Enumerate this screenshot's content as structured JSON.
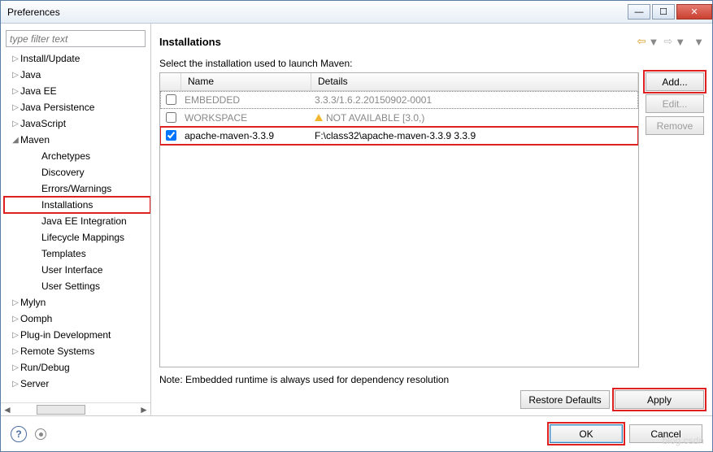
{
  "window": {
    "title": "Preferences"
  },
  "filter": {
    "placeholder": "type filter text"
  },
  "tree": {
    "items": [
      {
        "label": "Install/Update",
        "depth": 1,
        "exp": "▷"
      },
      {
        "label": "Java",
        "depth": 1,
        "exp": "▷"
      },
      {
        "label": "Java EE",
        "depth": 1,
        "exp": "▷"
      },
      {
        "label": "Java Persistence",
        "depth": 1,
        "exp": "▷"
      },
      {
        "label": "JavaScript",
        "depth": 1,
        "exp": "▷"
      },
      {
        "label": "Maven",
        "depth": 1,
        "exp": "◢"
      },
      {
        "label": "Archetypes",
        "depth": 2,
        "exp": ""
      },
      {
        "label": "Discovery",
        "depth": 2,
        "exp": ""
      },
      {
        "label": "Errors/Warnings",
        "depth": 2,
        "exp": ""
      },
      {
        "label": "Installations",
        "depth": 2,
        "exp": "",
        "hl": true
      },
      {
        "label": "Java EE Integration",
        "depth": 2,
        "exp": ""
      },
      {
        "label": "Lifecycle Mappings",
        "depth": 2,
        "exp": ""
      },
      {
        "label": "Templates",
        "depth": 2,
        "exp": ""
      },
      {
        "label": "User Interface",
        "depth": 2,
        "exp": ""
      },
      {
        "label": "User Settings",
        "depth": 2,
        "exp": ""
      },
      {
        "label": "Mylyn",
        "depth": 1,
        "exp": "▷"
      },
      {
        "label": "Oomph",
        "depth": 1,
        "exp": "▷"
      },
      {
        "label": "Plug-in Development",
        "depth": 1,
        "exp": "▷"
      },
      {
        "label": "Remote Systems",
        "depth": 1,
        "exp": "▷"
      },
      {
        "label": "Run/Debug",
        "depth": 1,
        "exp": "▷"
      },
      {
        "label": "Server",
        "depth": 1,
        "exp": "▷"
      }
    ]
  },
  "page": {
    "title": "Installations",
    "subtitle": "Select the installation used to launch Maven:",
    "columns": {
      "name": "Name",
      "details": "Details"
    },
    "rows": [
      {
        "checked": false,
        "name": "EMBEDDED",
        "details": "3.3.3/1.6.2.20150902-0001",
        "dotted": true
      },
      {
        "checked": false,
        "name": "WORKSPACE",
        "details": "NOT AVAILABLE [3.0,)",
        "warn": true
      },
      {
        "checked": true,
        "name": "apache-maven-3.3.9",
        "details": "F:\\class32\\apache-maven-3.3.9 3.3.9",
        "selected": true
      }
    ],
    "note": "Note: Embedded runtime is always used for dependency resolution",
    "buttons": {
      "add": "Add...",
      "edit": "Edit...",
      "remove": "Remove",
      "restore": "Restore Defaults",
      "apply": "Apply"
    }
  },
  "footer": {
    "ok": "OK",
    "cancel": "Cancel"
  },
  "watermark": "blog.csdn"
}
